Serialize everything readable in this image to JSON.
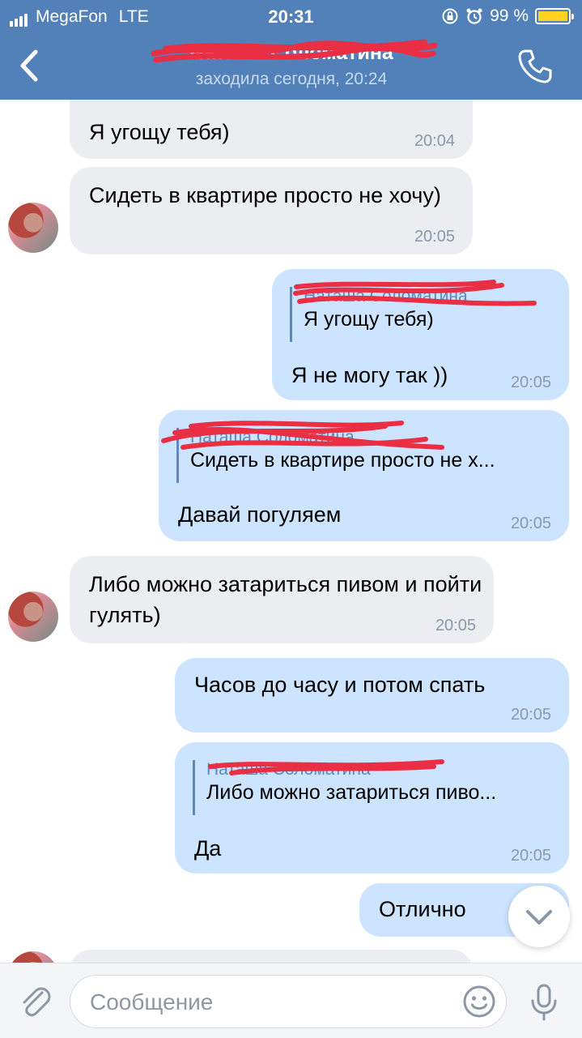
{
  "status_bar": {
    "carrier": "MegaFon",
    "network": "LTE",
    "time": "20:31",
    "battery": "99 %",
    "battery_color": "#ffd21f"
  },
  "header": {
    "contact_name": "Наташа Соломатина",
    "last_seen": "заходила сегодня, 20:24",
    "back_icon": "chevron-left-icon",
    "call_icon": "phone-icon",
    "background": "#5181b8"
  },
  "messages": [
    {
      "dir": "in",
      "text": "Я угощу тебя)",
      "time": "20:04"
    },
    {
      "dir": "in",
      "text": "Сидеть в квартире просто не хочу)",
      "time": "20:05"
    },
    {
      "dir": "out",
      "reply_to": {
        "name": "Наташа Соломатина",
        "text": "Я угощу тебя)"
      },
      "text": "Я не могу так ))",
      "time": "20:05"
    },
    {
      "dir": "out",
      "reply_to": {
        "name": "Наташа Соломатина",
        "text": "Сидеть в квартире просто не х..."
      },
      "text": "Давай погуляем",
      "time": "20:05"
    },
    {
      "dir": "in",
      "text": "Либо можно затариться пивом и пойти гулять)",
      "time": "20:05"
    },
    {
      "dir": "out",
      "text": "Часов до часу и потом спать",
      "time": "20:05"
    },
    {
      "dir": "out",
      "reply_to": {
        "name": "Наташа Соломатина",
        "text": "Либо можно затариться пиво..."
      },
      "text": "Да",
      "time": "20:05"
    },
    {
      "dir": "out",
      "text": "Отлично",
      "time": ""
    }
  ],
  "composer": {
    "placeholder": "Сообщение",
    "value": ""
  },
  "colors": {
    "incoming_bubble": "#ebedf0",
    "outgoing_bubble": "#cce4ff",
    "accent": "#5181b8"
  }
}
